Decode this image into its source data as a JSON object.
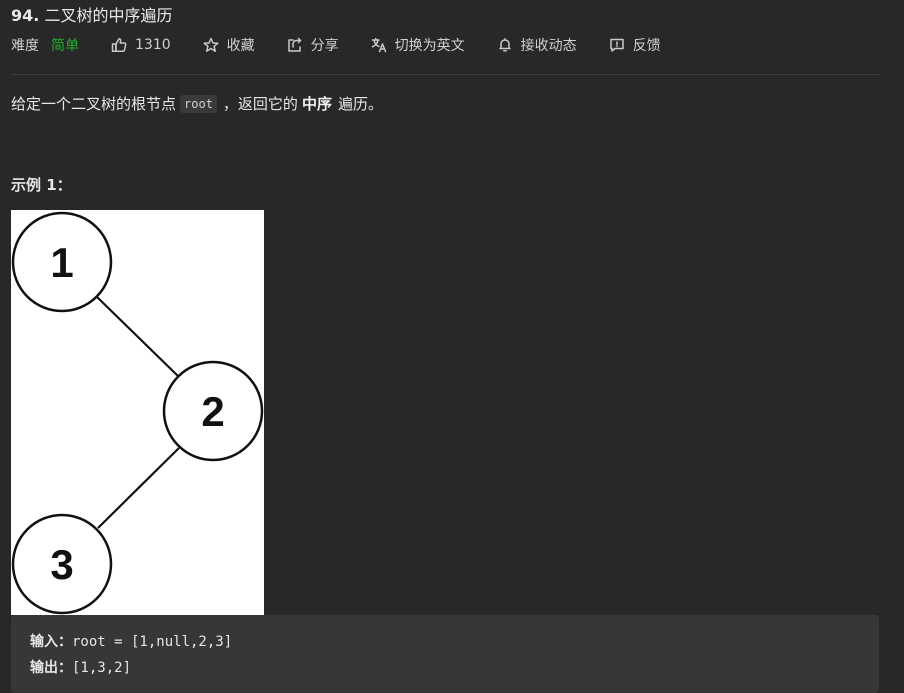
{
  "problem": {
    "number": "94.",
    "title": "二叉树的中序遍历"
  },
  "meta": {
    "difficulty_label": "难度",
    "difficulty_value": "简单",
    "likes": "1310",
    "favorite": "收藏",
    "share": "分享",
    "translate": "切换为英文",
    "subscribe": "接收动态",
    "feedback": "反馈"
  },
  "description": {
    "prefix": "给定一个二叉树的根节点",
    "code": "root",
    "middle": "，返回它的",
    "bold": "中序",
    "suffix": "遍历。"
  },
  "example": {
    "title": "示例 1：",
    "tree_nodes": [
      "1",
      "2",
      "3"
    ],
    "input_label": "输入：",
    "input_value": "root = [1,null,2,3]",
    "output_label": "输出：",
    "output_value": "[1,3,2]"
  },
  "colors": {
    "background": "#282828",
    "difficulty_easy": "#1fb02b",
    "code_box": "#373737"
  },
  "icons": [
    "thumbs-up-icon",
    "star-icon",
    "share-icon",
    "translate-icon",
    "bell-icon",
    "feedback-icon"
  ]
}
